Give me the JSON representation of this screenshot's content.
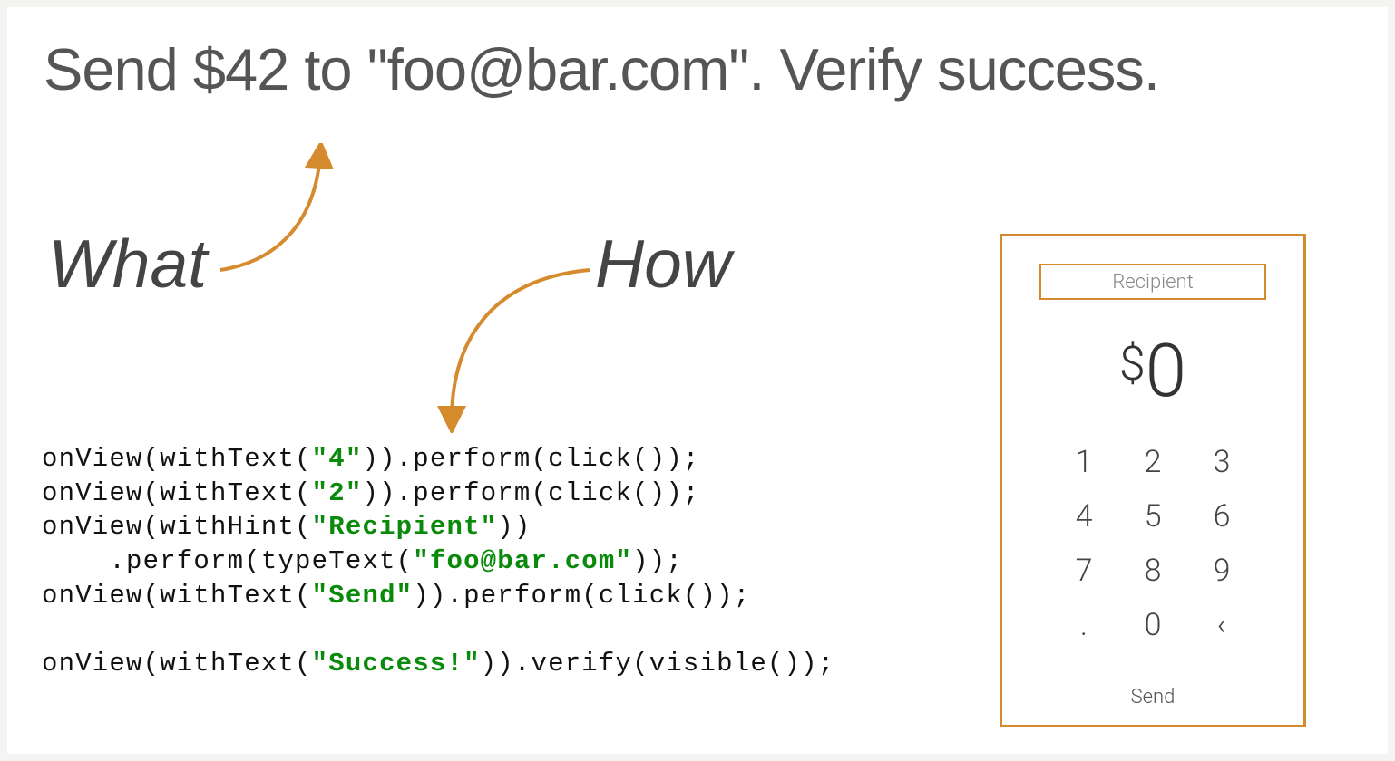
{
  "headline": "Send $42 to \"foo@bar.com\". Verify success.",
  "labels": {
    "what": "What",
    "how": "How"
  },
  "code": {
    "lines": [
      {
        "prefix": "onView(withText(",
        "str": "\"4\"",
        "suffix": ")).perform(click());"
      },
      {
        "prefix": "onView(withText(",
        "str": "\"2\"",
        "suffix": ")).perform(click());"
      },
      {
        "prefix": "onView(withHint(",
        "str": "\"Recipient\"",
        "suffix": "))"
      },
      {
        "prefix": "    .perform(typeText(",
        "str": "\"foo@bar.com\"",
        "suffix": "));"
      },
      {
        "prefix": "onView(withText(",
        "str": "\"Send\"",
        "suffix": ")).perform(click());"
      },
      {
        "empty": true
      },
      {
        "prefix": "onView(withText(",
        "str": "\"Success!\"",
        "suffix": ")).verify(visible());"
      }
    ]
  },
  "phone": {
    "recipient_placeholder": "Recipient",
    "currency_symbol": "$",
    "amount": "0",
    "keypad": [
      "1",
      "2",
      "3",
      "4",
      "5",
      "6",
      "7",
      "8",
      "9",
      ".",
      "0",
      "<"
    ],
    "send_label": "Send"
  },
  "colors": {
    "accent": "#d68a2e",
    "code_string": "#0a8a0a"
  }
}
